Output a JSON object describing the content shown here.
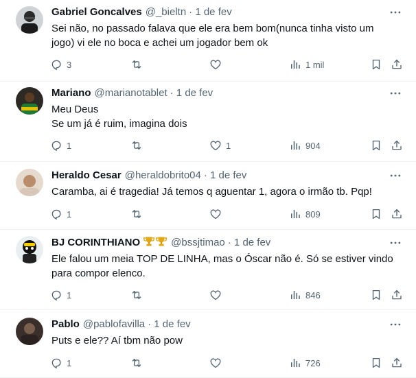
{
  "replies": [
    {
      "name": "Gabriel Goncalves",
      "handle": "@_bieltn",
      "date": "· 1 de fev",
      "lines": [
        "Sei não, no passado falava que ele era bem bom(nunca tinha visto um",
        "jogo) vi ele no boca e achei um jogador bem ok"
      ],
      "reply_count": "3",
      "retweet_count": "",
      "like_count": "",
      "view_count": "1 mil"
    },
    {
      "name": "Mariano",
      "handle": "@marianotablet",
      "date": "· 1 de fev",
      "lines": [
        "Meu Deus",
        "Se um já é ruim, imagina dois"
      ],
      "reply_count": "1",
      "retweet_count": "",
      "like_count": "1",
      "view_count": "904"
    },
    {
      "name": "Heraldo Cesar",
      "handle": "@heraldobrito04",
      "date": "· 1 de fev",
      "lines": [
        "Caramba, ai é tragedia! Já temos q aguentar 1, agora o irmão tb. Pqp!"
      ],
      "reply_count": "1",
      "retweet_count": "",
      "like_count": "",
      "view_count": "809"
    },
    {
      "name": "BJ CORINTHIANO",
      "handle": "@bssjtimao",
      "date": "· 1 de fev",
      "lines": [
        "Ele falou um meia TOP DE LINHA,  mas o Óscar não é. Só se estiver vindo",
        "para compor elenco."
      ],
      "reply_count": "1",
      "retweet_count": "",
      "like_count": "",
      "view_count": "846"
    },
    {
      "name": "Pablo",
      "handle": "@pablofavilla",
      "date": "· 1 de fev",
      "lines": [
        "Puts e ele?? Aí tbm não pow"
      ],
      "reply_count": "1",
      "retweet_count": "",
      "like_count": "",
      "view_count": "726"
    }
  ],
  "icons": {
    "reply": "reply-icon",
    "retweet": "retweet-icon",
    "like": "like-icon",
    "views": "views-icon",
    "bookmark": "bookmark-icon",
    "share": "share-icon",
    "more": "more-icon",
    "trophy": "trophy-icon"
  },
  "colors": {
    "text": "#0f1419",
    "muted": "#536471",
    "divider": "#eff3f4",
    "trophy": "#d4a017"
  }
}
